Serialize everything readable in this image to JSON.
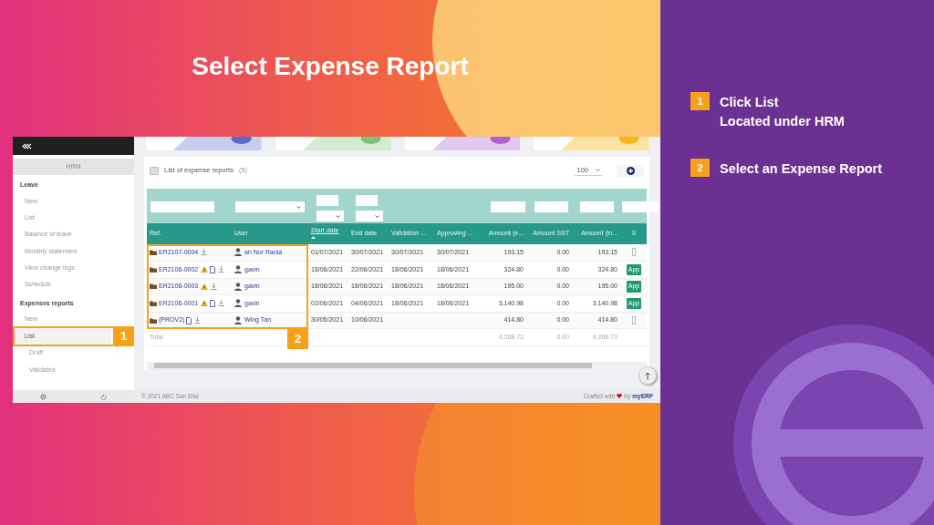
{
  "slide": {
    "title": "Select Expense Report"
  },
  "steps": [
    {
      "number": "1",
      "lines": [
        "Click List",
        "Located under HRM"
      ]
    },
    {
      "number": "2",
      "lines": [
        "Select an Expense Report"
      ]
    }
  ],
  "app": {
    "sidebar": {
      "header": "HRM",
      "sections": [
        {
          "title": "Leave",
          "items": [
            {
              "label": "New",
              "selected": false
            },
            {
              "label": "List",
              "selected": false
            },
            {
              "label": "Balance of leave",
              "selected": false
            },
            {
              "label": "Monthly statement",
              "selected": false
            },
            {
              "label": "View change logs",
              "selected": false
            },
            {
              "label": "Schedule",
              "selected": false
            }
          ]
        },
        {
          "title": "Expenses reports",
          "items": [
            {
              "label": "New",
              "selected": false
            },
            {
              "label": "List",
              "selected": true,
              "children": [
                {
                  "label": "Draft",
                  "selected": false
                },
                {
                  "label": "Validated",
                  "selected": false
                }
              ]
            }
          ]
        }
      ]
    },
    "panel": {
      "title": "List of expense reports",
      "count": "(5)",
      "page_size": "100",
      "columns": [
        {
          "label": "Ref.",
          "sorted": false
        },
        {
          "label": "User",
          "sorted": false
        },
        {
          "label": "Start date",
          "sorted": true
        },
        {
          "label": "End date",
          "sorted": false
        },
        {
          "label": "Validation ...",
          "sorted": false
        },
        {
          "label": "Approving ...",
          "sorted": false
        },
        {
          "label": "Amount (e...",
          "sorted": false
        },
        {
          "label": "Amount SST",
          "sorted": false
        },
        {
          "label": "Amount (in...",
          "sorted": false
        },
        {
          "label": "S",
          "sorted": false
        }
      ],
      "rows": [
        {
          "ref": "ER2107-0004",
          "warning": false,
          "document": false,
          "user": "ah Nur Rania",
          "start": "01/07/2021",
          "end": "30/07/2021",
          "validation": "30/07/2021",
          "approving": "30/07/2021",
          "amount_excl": "193.15",
          "sst": "0.00",
          "amount_incl": "193.15",
          "status": {
            "kind": "field"
          }
        },
        {
          "ref": "ER2106-0002",
          "warning": true,
          "document": true,
          "user": "gavin",
          "start": "18/06/2021",
          "end": "22/06/2021",
          "validation": "18/06/2021",
          "approving": "18/06/2021",
          "amount_excl": "324.80",
          "sst": "0.00",
          "amount_incl": "324.80",
          "status": {
            "kind": "badge",
            "text": "App"
          }
        },
        {
          "ref": "ER2106-0003",
          "warning": true,
          "document": false,
          "user": "gavin",
          "start": "18/06/2021",
          "end": "18/06/2021",
          "validation": "18/06/2021",
          "approving": "18/06/2021",
          "amount_excl": "195.00",
          "sst": "0.00",
          "amount_incl": "195.00",
          "status": {
            "kind": "badge",
            "text": "App"
          }
        },
        {
          "ref": "ER2106-0001",
          "warning": true,
          "document": true,
          "user": "gavin",
          "start": "02/06/2021",
          "end": "04/06/2021",
          "validation": "18/06/2021",
          "approving": "18/06/2021",
          "amount_excl": "3,140.98",
          "sst": "0.00",
          "amount_incl": "3,140.98",
          "status": {
            "kind": "badge",
            "text": "App"
          }
        },
        {
          "ref": "(PROV2)",
          "warning": false,
          "document": true,
          "user": "Wing Tan",
          "start": "30/05/2021",
          "end": "10/06/2021",
          "amount_excl": "414.80",
          "sst": "0.00",
          "amount_incl": "414.80",
          "status": {
            "kind": "field"
          }
        }
      ],
      "total": {
        "label": "Total",
        "amount_excl": "4,268.73",
        "sst": "0.00",
        "amount_incl": "4,268.73"
      }
    },
    "footer": {
      "copyright": "© 2021 ABC Sdn Bhd",
      "crafted": "Crafted with",
      "by": "by",
      "brand": "myERP"
    }
  },
  "callouts": [
    {
      "number": "1",
      "kind": "sidebar"
    },
    {
      "number": "2",
      "kind": "table"
    }
  ]
}
